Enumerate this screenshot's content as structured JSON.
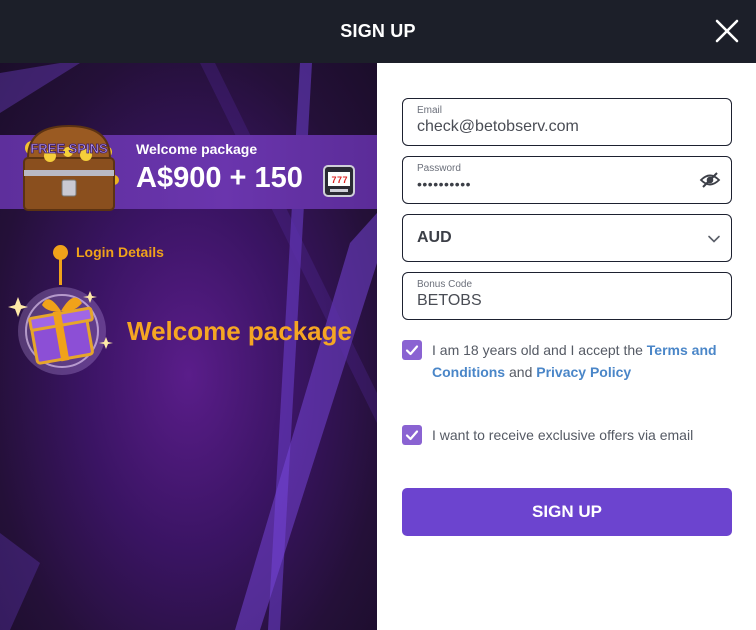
{
  "header": {
    "title": "SIGN UP"
  },
  "promo": {
    "banner_title": "Welcome package",
    "banner_amount": "A$900 + 150",
    "chest_text": "FREE SPINS",
    "step_label": "Login Details",
    "welcome_big": "Welcome package"
  },
  "form": {
    "email": {
      "label": "Email",
      "value": "check@betobserv.com"
    },
    "password": {
      "label": "Password",
      "value": "••••••••••"
    },
    "currency": {
      "value": "AUD"
    },
    "bonus": {
      "label": "Bonus Code",
      "value": "BETOBS"
    },
    "terms": {
      "prefix": "I am 18 years old and I accept the ",
      "terms_link": "Terms and Conditions",
      "middle": " and ",
      "privacy_link": "Privacy Policy",
      "checked": true
    },
    "offers": {
      "label": "I want to receive exclusive offers via email",
      "checked": true
    },
    "submit_label": "SIGN UP"
  },
  "colors": {
    "accent": "#6c44cf",
    "checkbox": "#8a63d2",
    "link": "#4a86c8",
    "promo_orange": "#f5a623",
    "header_bg": "#1c1f29"
  }
}
